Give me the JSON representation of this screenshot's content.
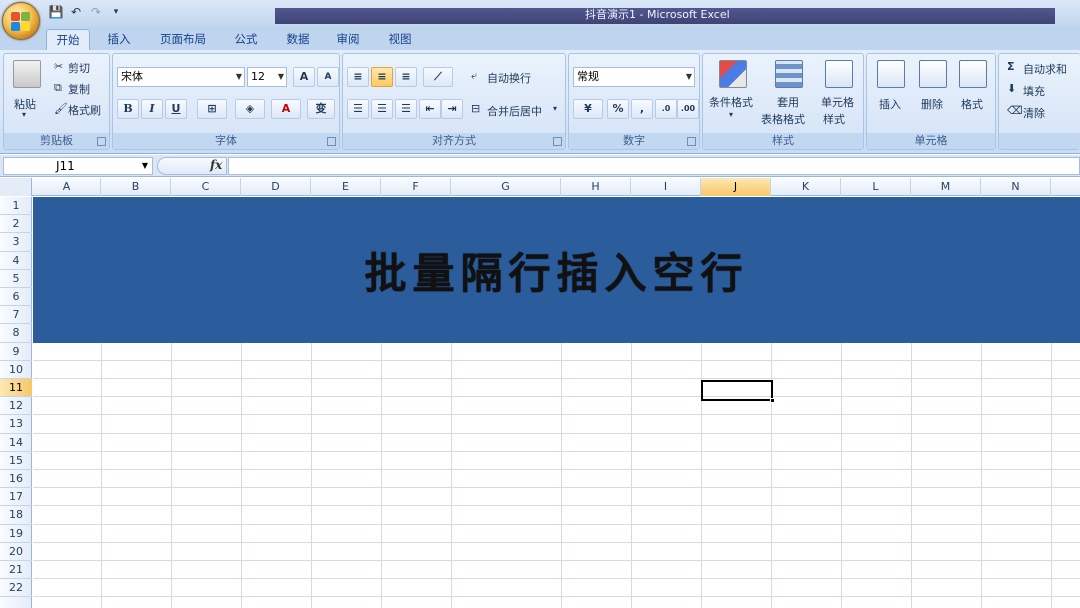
{
  "window": {
    "title": "抖音演示1 - Microsoft Excel"
  },
  "tabs": [
    "开始",
    "插入",
    "页面布局",
    "公式",
    "数据",
    "审阅",
    "视图"
  ],
  "active_tab": "开始",
  "ribbon": {
    "clipboard": {
      "label": "剪贴板",
      "paste": "粘贴",
      "cut": "剪切",
      "copy": "复制",
      "format_painter": "格式刷"
    },
    "font": {
      "label": "字体",
      "font_name": "宋体",
      "font_size": "12",
      "bold": "B",
      "italic": "I",
      "underline": "U",
      "grow": "A",
      "shrink": "A",
      "font_color": "A",
      "phonetic": "变"
    },
    "alignment": {
      "label": "对齐方式",
      "wrap_text": "自动换行",
      "merge_center": "合并后居中"
    },
    "number": {
      "label": "数字",
      "format": "常规",
      "percent": "%",
      "comma": ","
    },
    "styles": {
      "label": "样式",
      "conditional": "条件格式",
      "table_l1": "套用",
      "table_l2": "表格格式",
      "cell_styles_l1": "单元格",
      "cell_styles_l2": "样式"
    },
    "cells": {
      "label": "单元格",
      "insert": "插入",
      "delete": "删除",
      "format": "格式"
    },
    "editing": {
      "autosum": "自动求和",
      "fill": "填充",
      "clear": "清除"
    }
  },
  "formula_bar": {
    "name_box": "J11",
    "fx": "fx",
    "value": ""
  },
  "columns": [
    "A",
    "B",
    "C",
    "D",
    "E",
    "F",
    "G",
    "H",
    "I",
    "J",
    "K",
    "L",
    "M",
    "N"
  ],
  "rows": [
    "1",
    "2",
    "3",
    "4",
    "5",
    "6",
    "7",
    "8",
    "9",
    "10",
    "11",
    "12",
    "13",
    "14",
    "15",
    "16",
    "17",
    "18",
    "19",
    "20",
    "21",
    "22"
  ],
  "selected_column": "J",
  "selected_row": "11",
  "banner": {
    "text": "批量隔行插入空行",
    "color": "#2b5c9b"
  }
}
